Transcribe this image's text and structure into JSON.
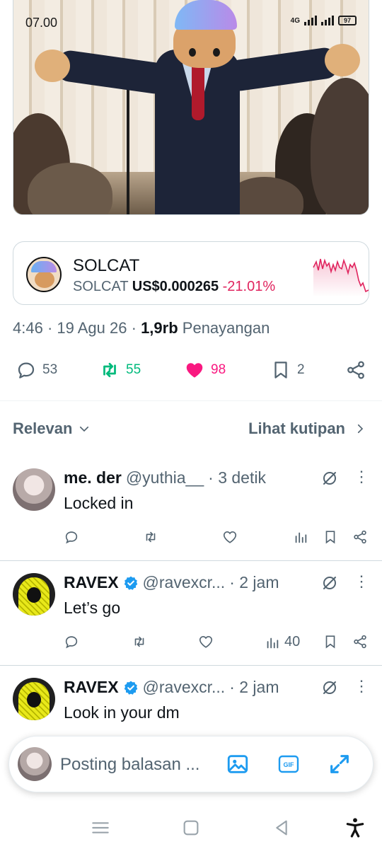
{
  "status_bar": {
    "time": "07.00",
    "network": "4G",
    "battery": "97"
  },
  "token": {
    "name": "SOLCAT",
    "symbol": "SOLCAT",
    "price": "US$0.000265",
    "change": "-21.01%",
    "change_color": "#e0245e"
  },
  "post_meta": {
    "time": "4:46",
    "date": "19 Agu 26",
    "views_count": "1,9rb",
    "views_label": "Penayangan"
  },
  "actions": {
    "replies": "53",
    "reposts": "55",
    "likes": "98",
    "bookmarks": "2"
  },
  "sort": {
    "relevance_label": "Relevan",
    "quotes_label": "Lihat kutipan"
  },
  "replies": [
    {
      "name": "me. der",
      "handle": "@yuthia__",
      "time": "· 3 detik",
      "text": "Locked in",
      "verified": false,
      "views": ""
    },
    {
      "name": "RAVEX",
      "handle": "@ravexcr...",
      "time": "· 2 jam",
      "text": "Let’s go",
      "verified": true,
      "views": "40"
    },
    {
      "name": "RAVEX",
      "handle": "@ravexcr...",
      "time": "· 2 jam",
      "text": "Look in your dm",
      "verified": true,
      "views": ""
    }
  ],
  "compose": {
    "placeholder": "Posting balasan ..."
  },
  "icons": {
    "gif": "GIF"
  },
  "colors": {
    "accent": "#1d9bf0",
    "repost": "#00ba7c",
    "like": "#f91880",
    "muted": "#536471"
  }
}
